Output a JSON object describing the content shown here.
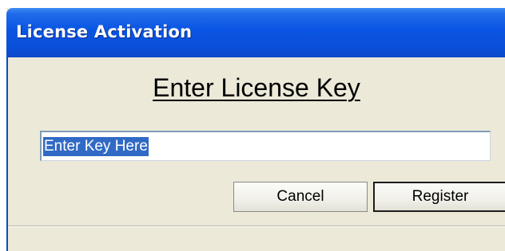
{
  "window": {
    "title": "License Activation"
  },
  "dialog": {
    "heading": "Enter License Key",
    "key_field": {
      "value": "Enter Key Here",
      "selected": true
    },
    "buttons": {
      "cancel_label": "Cancel",
      "register_label": "Register"
    }
  },
  "colors": {
    "titlebar": "#0a54e3",
    "dialog_background": "#ece9d8",
    "selection_highlight": "#316ac5"
  }
}
